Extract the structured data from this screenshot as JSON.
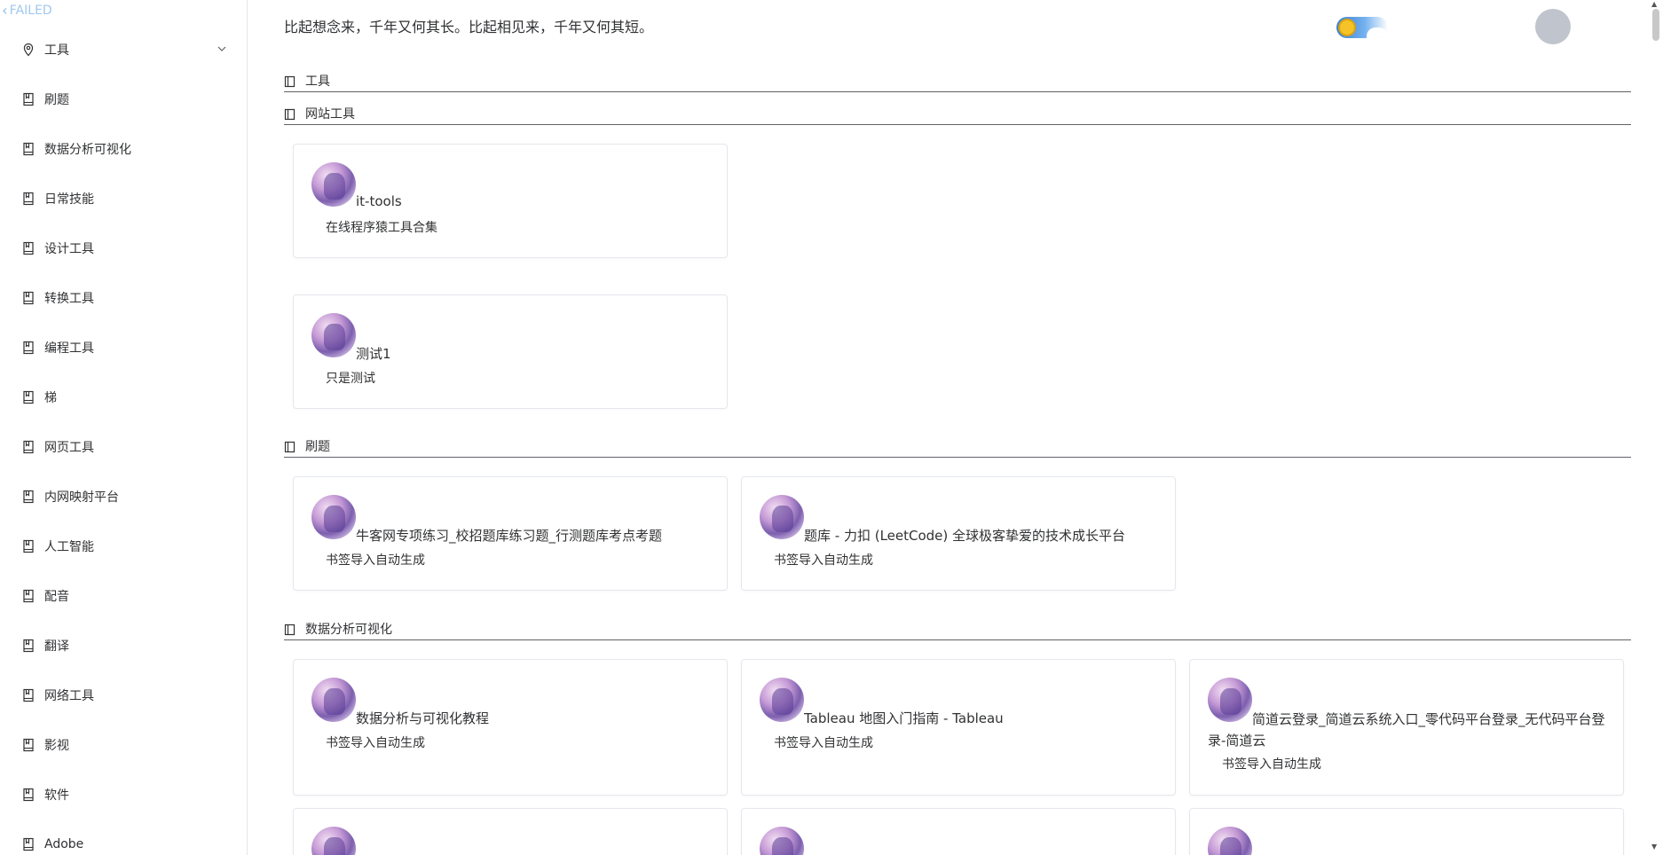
{
  "header": {
    "failed_label": "FAILED",
    "quote": "比起想念来，千年又何其长。比起相见来，千年又何其短。"
  },
  "sidebar": {
    "items": [
      {
        "label": "工具",
        "icon": "location-icon",
        "expandable": true
      },
      {
        "label": "刷题",
        "icon": "bookmark-icon"
      },
      {
        "label": "数据分析可视化",
        "icon": "bookmark-icon"
      },
      {
        "label": "日常技能",
        "icon": "bookmark-icon"
      },
      {
        "label": "设计工具",
        "icon": "bookmark-icon"
      },
      {
        "label": "转换工具",
        "icon": "bookmark-icon"
      },
      {
        "label": "编程工具",
        "icon": "bookmark-icon"
      },
      {
        "label": "梯",
        "icon": "bookmark-icon"
      },
      {
        "label": "网页工具",
        "icon": "bookmark-icon"
      },
      {
        "label": "内网映射平台",
        "icon": "bookmark-icon"
      },
      {
        "label": "人工智能",
        "icon": "bookmark-icon"
      },
      {
        "label": "配音",
        "icon": "bookmark-icon"
      },
      {
        "label": "翻译",
        "icon": "bookmark-icon"
      },
      {
        "label": "网络工具",
        "icon": "bookmark-icon"
      },
      {
        "label": "影视",
        "icon": "bookmark-icon"
      },
      {
        "label": "软件",
        "icon": "bookmark-icon"
      },
      {
        "label": "Adobe",
        "icon": "bookmark-icon"
      }
    ]
  },
  "sections": {
    "tools": {
      "title": "工具"
    },
    "web_tools": {
      "title": "网站工具",
      "cards": [
        {
          "title": "it-tools",
          "desc": "在线程序猿工具合集"
        },
        {
          "title": "测试1",
          "desc": "只是测试"
        }
      ]
    },
    "practice": {
      "title": "刷题",
      "cards": [
        {
          "title": "牛客网专项练习_校招题库练习题_行测题库考点考题",
          "desc": "书签导入自动生成"
        },
        {
          "title": "题库 - 力扣 (LeetCode) 全球极客挚爱的技术成长平台",
          "desc": "书签导入自动生成"
        }
      ]
    },
    "data_viz": {
      "title": "数据分析可视化",
      "cards": [
        {
          "title": "数据分析与可视化教程",
          "desc": "书签导入自动生成"
        },
        {
          "title": "Tableau 地图入门指南 - Tableau",
          "desc": "书签导入自动生成"
        },
        {
          "title": "简道云登录_简道云系统入口_零代码平台登录_无代码平台登录-简道云",
          "desc": "书签导入自动生成"
        }
      ]
    }
  },
  "colors": {
    "accent": "#409eff",
    "border": "#e4e7ed",
    "text": "#303133",
    "failed": "#a0c8ef"
  }
}
